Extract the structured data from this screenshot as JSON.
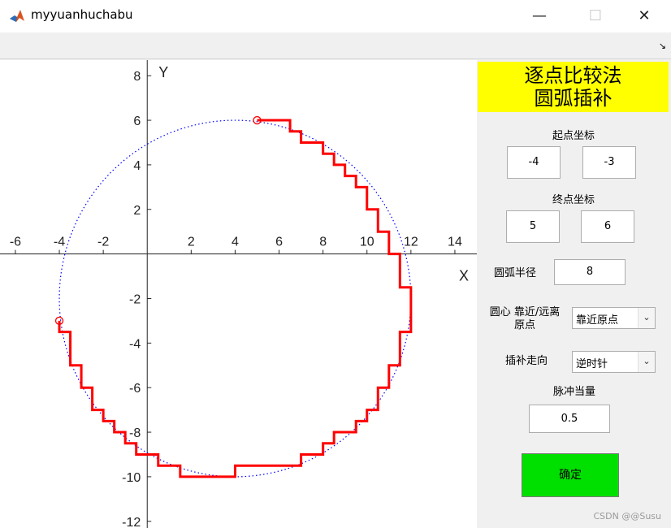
{
  "window": {
    "title": "myyuanhuchabu",
    "minimize_glyph": "—",
    "maximize_glyph": "☐",
    "close_glyph": "✕"
  },
  "toolstrip": {
    "undock_glyph": "↘"
  },
  "colors": {
    "banner": "#ffff00",
    "confirm_button": "#00e000",
    "circle": "#0000ff",
    "path": "#ff0000"
  },
  "panel": {
    "banner_line1": "逐点比较法",
    "banner_line2": "圆弧插补",
    "start_label": "起点坐标",
    "start_x": "-4",
    "start_y": "-3",
    "end_label": "终点坐标",
    "end_x": "5",
    "end_y": "6",
    "radius_label": "圆弧半径",
    "radius": "8",
    "center_label_line1": "圆心 靠近/远离",
    "center_label_line2": "原点",
    "center_option": "靠近原点",
    "direction_label": "插补走向",
    "direction_option": "逆时针",
    "pulse_label": "脉冲当量",
    "pulse": "0.5",
    "confirm_label": "确定"
  },
  "watermark": "CSDN @@Susu",
  "chart_data": {
    "type": "line",
    "xlabel": "X",
    "ylabel": "Y",
    "xlim": [
      -6.7,
      15
    ],
    "ylim": [
      -12.3,
      8.7
    ],
    "xticks": [
      -6,
      -4,
      -2,
      2,
      4,
      6,
      8,
      10,
      12,
      14
    ],
    "yticks": [
      8,
      6,
      4,
      2,
      -2,
      -4,
      -6,
      -8,
      -10,
      -12
    ],
    "circle": {
      "center": [
        4,
        -2
      ],
      "radius": 8,
      "style": "dotted",
      "color": "#0000ff"
    },
    "endpoints": [
      [
        -4,
        -3
      ],
      [
        5,
        6
      ]
    ],
    "step_size": 0.5,
    "step_path": [
      [
        -4,
        -3
      ],
      [
        -4,
        -3.5
      ],
      [
        -3.5,
        -3.5
      ],
      [
        -3.5,
        -5
      ],
      [
        -3,
        -5
      ],
      [
        -3,
        -6
      ],
      [
        -2.5,
        -6
      ],
      [
        -2.5,
        -7
      ],
      [
        -2,
        -7
      ],
      [
        -2,
        -7.5
      ],
      [
        -1.5,
        -7.5
      ],
      [
        -1.5,
        -8
      ],
      [
        -1,
        -8
      ],
      [
        -1,
        -8.5
      ],
      [
        -0.5,
        -8.5
      ],
      [
        -0.5,
        -9
      ],
      [
        0.5,
        -9
      ],
      [
        0.5,
        -9.5
      ],
      [
        1.5,
        -9.5
      ],
      [
        1.5,
        -10
      ],
      [
        4,
        -10
      ],
      [
        4,
        -9.5
      ],
      [
        7,
        -9.5
      ],
      [
        7,
        -9
      ],
      [
        8,
        -9
      ],
      [
        8,
        -8.5
      ],
      [
        8.5,
        -8.5
      ],
      [
        8.5,
        -8
      ],
      [
        9.5,
        -8
      ],
      [
        9.5,
        -7.5
      ],
      [
        10,
        -7.5
      ],
      [
        10,
        -7
      ],
      [
        10.5,
        -7
      ],
      [
        10.5,
        -6
      ],
      [
        11,
        -6
      ],
      [
        11,
        -5
      ],
      [
        11.5,
        -5
      ],
      [
        11.5,
        -3.5
      ],
      [
        12,
        -3.5
      ],
      [
        12,
        -1.5
      ],
      [
        11.5,
        -1.5
      ],
      [
        11.5,
        0
      ],
      [
        11,
        0
      ],
      [
        11,
        1
      ],
      [
        10.5,
        1
      ],
      [
        10.5,
        2
      ],
      [
        10,
        2
      ],
      [
        10,
        3
      ],
      [
        9.5,
        3
      ],
      [
        9.5,
        3.5
      ],
      [
        9,
        3.5
      ],
      [
        9,
        4
      ],
      [
        8.5,
        4
      ],
      [
        8.5,
        4.5
      ],
      [
        8,
        4.5
      ],
      [
        8,
        5
      ],
      [
        7,
        5
      ],
      [
        7,
        5.5
      ],
      [
        6.5,
        5.5
      ],
      [
        6.5,
        6
      ],
      [
        5,
        6
      ]
    ]
  }
}
